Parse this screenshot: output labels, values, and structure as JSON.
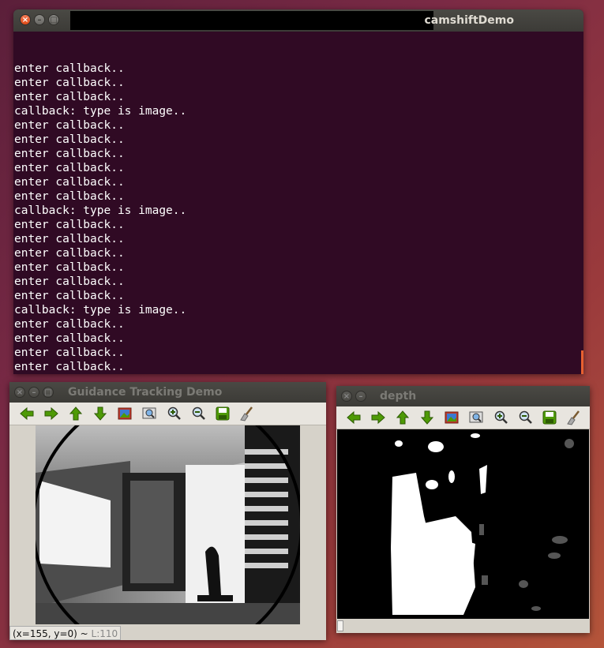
{
  "terminal": {
    "title": "camshiftDemo",
    "lines": [
      "enter callback..",
      "enter callback..",
      "enter callback..",
      "callback: type is image..",
      "enter callback..",
      "enter callback..",
      "enter callback..",
      "enter callback..",
      "enter callback..",
      "enter callback..",
      "callback: type is image..",
      "enter callback..",
      "enter callback..",
      "enter callback..",
      "enter callback..",
      "enter callback..",
      "enter callback..",
      "callback: type is image..",
      "enter callback..",
      "enter callback..",
      "enter callback..",
      "enter callback..",
      "enter callback.."
    ]
  },
  "window_buttons": {
    "close": "×",
    "minimize": "–",
    "maximize": "□"
  },
  "guidance": {
    "title": "Guidance Tracking Demo",
    "status_coords": "(x=155, y=0) ~ ",
    "status_value": "L:110"
  },
  "depth": {
    "title": "depth"
  },
  "toolbar_icons": [
    "arrow-left-icon",
    "arrow-right-icon",
    "arrow-up-icon",
    "arrow-down-icon",
    "image-icon",
    "zoom-fit-icon",
    "zoom-in-icon",
    "zoom-out-icon",
    "save-icon",
    "clear-brush-icon"
  ],
  "colors": {
    "terminal_bg": "#300a24",
    "toolbar_green": "#4e9a06",
    "scroll_accent": "#e86030"
  }
}
